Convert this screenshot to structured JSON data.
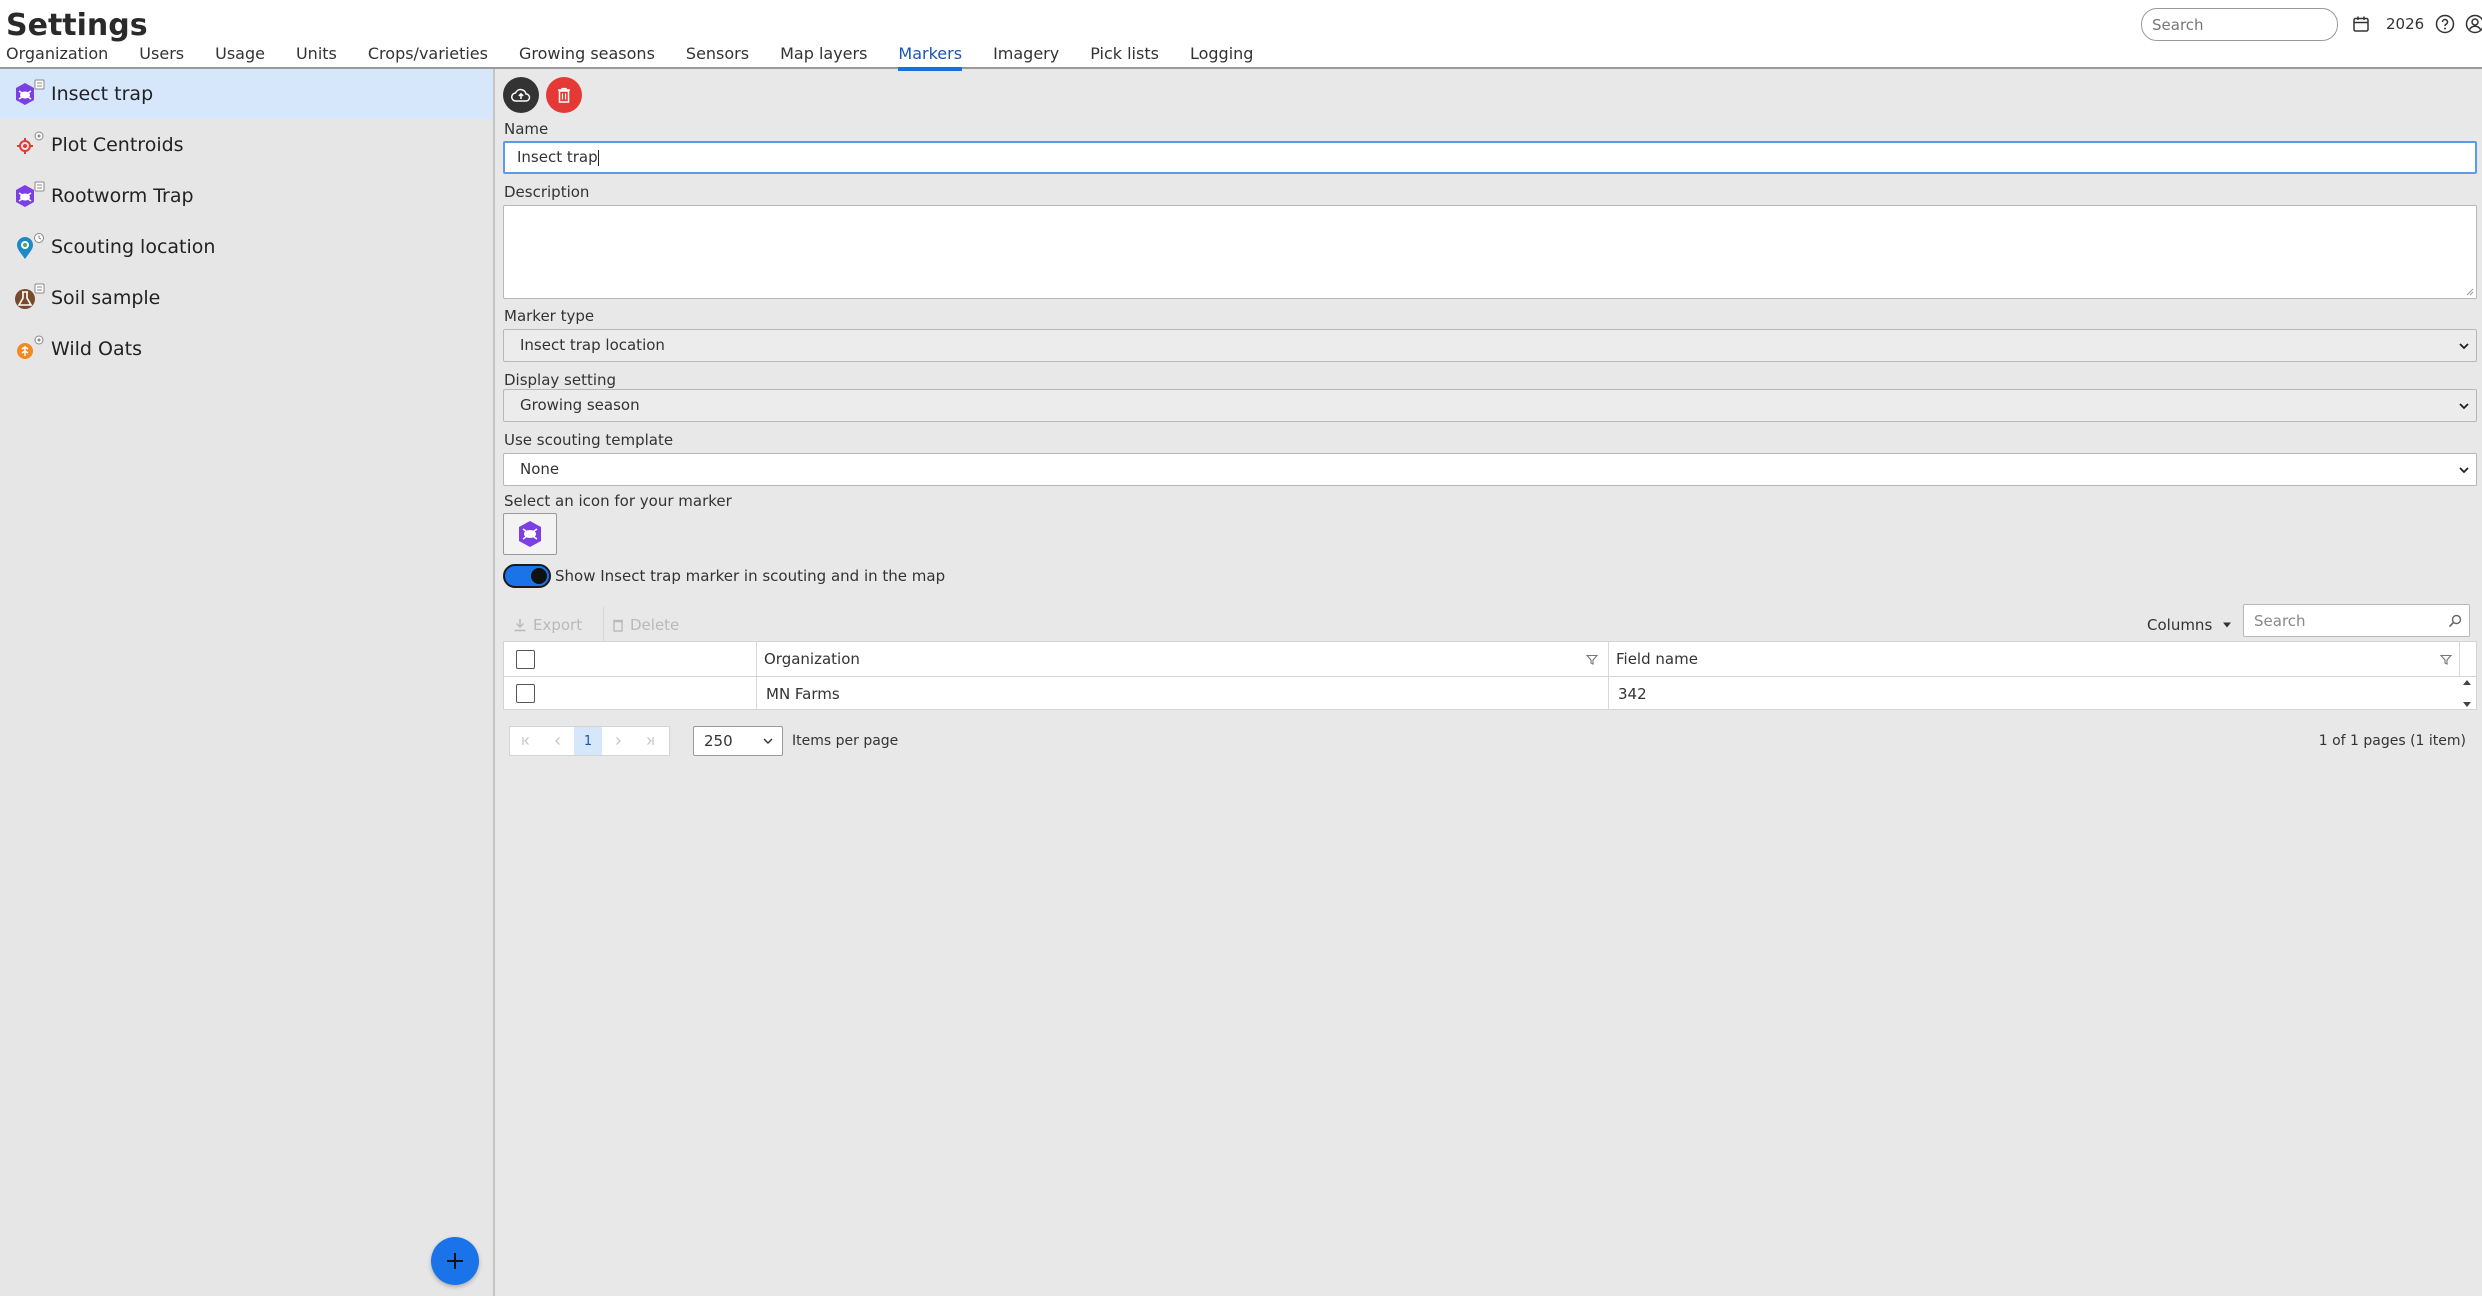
{
  "app": {
    "title": "Settings",
    "tabs": [
      {
        "label": "Organization"
      },
      {
        "label": "Users"
      },
      {
        "label": "Usage"
      },
      {
        "label": "Units"
      },
      {
        "label": "Crops/varieties"
      },
      {
        "label": "Growing seasons"
      },
      {
        "label": "Sensors"
      },
      {
        "label": "Map layers"
      },
      {
        "label": "Markers",
        "active": true
      },
      {
        "label": "Imagery"
      },
      {
        "label": "Pick lists"
      },
      {
        "label": "Logging"
      }
    ],
    "search_placeholder": "Search",
    "year": "2026"
  },
  "sidebar": {
    "items": [
      {
        "label": "Insect trap",
        "icon": "insect-trap-icon",
        "selected": true
      },
      {
        "label": "Plot Centroids",
        "icon": "plot-centroid-icon"
      },
      {
        "label": "Rootworm Trap",
        "icon": "rootworm-trap-icon"
      },
      {
        "label": "Scouting location",
        "icon": "scouting-location-icon"
      },
      {
        "label": "Soil sample",
        "icon": "soil-sample-icon"
      },
      {
        "label": "Wild Oats",
        "icon": "wild-oats-icon"
      }
    ]
  },
  "form": {
    "name_label": "Name",
    "name_value": "Insect trap",
    "description_label": "Description",
    "description_value": "",
    "marker_type_label": "Marker type",
    "marker_type_value": "Insect trap location",
    "display_setting_label": "Display setting",
    "display_setting_value": "Growing season",
    "scouting_template_label": "Use scouting template",
    "scouting_template_value": "None",
    "icon_label": "Select an icon for your marker",
    "toggle_label": "Show Insect trap marker in scouting and in the map",
    "toggle_on": true
  },
  "grid": {
    "export_label": "Export",
    "delete_label": "Delete",
    "columns_label": "Columns",
    "search_placeholder": "Search",
    "headers": {
      "organization": "Organization",
      "field_name": "Field name"
    },
    "rows": [
      {
        "organization": "MN Farms",
        "field_name": "342"
      }
    ],
    "current_page": "1",
    "per_page": "250",
    "per_page_label": "Items per page",
    "pager_info": "1 of 1 pages (1 item)"
  },
  "colors": {
    "accent": "#1a73e8",
    "delete_button": "#e53935",
    "save_button": "#333333",
    "marker_purple": "#7b3fe4"
  }
}
